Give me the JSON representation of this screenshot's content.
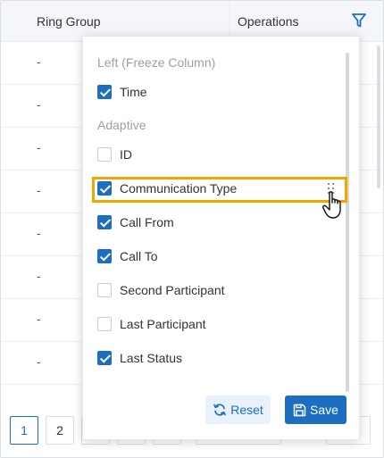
{
  "table": {
    "headers": {
      "ring_group": "Ring Group",
      "operations": "Operations"
    },
    "rows": [
      "-",
      "-",
      "-",
      "-",
      "-",
      "-",
      "-",
      "-"
    ]
  },
  "pagination": {
    "pages": [
      "1",
      "2"
    ],
    "active_page": "1"
  },
  "column_panel": {
    "group_freeze": "Left (Freeze Column)",
    "group_adaptive": "Adaptive",
    "options": [
      {
        "label": "Time",
        "checked": true
      },
      {
        "label": "ID",
        "checked": false
      },
      {
        "label": "Communication Type",
        "checked": true
      },
      {
        "label": "Call From",
        "checked": true
      },
      {
        "label": "Call To",
        "checked": true
      },
      {
        "label": "Second Participant",
        "checked": false
      },
      {
        "label": "Last Participant",
        "checked": false
      },
      {
        "label": "Last Status",
        "checked": true
      }
    ],
    "reset_label": "Reset",
    "save_label": "Save",
    "highlight_color": "#f0a500"
  },
  "colors": {
    "accent": "#1b6ec2",
    "header_bg": "#f4f6fa"
  },
  "icons": [
    "filter-icon",
    "drag-handle-icon",
    "hand-pointer-icon",
    "reset-icon",
    "save-icon"
  ]
}
